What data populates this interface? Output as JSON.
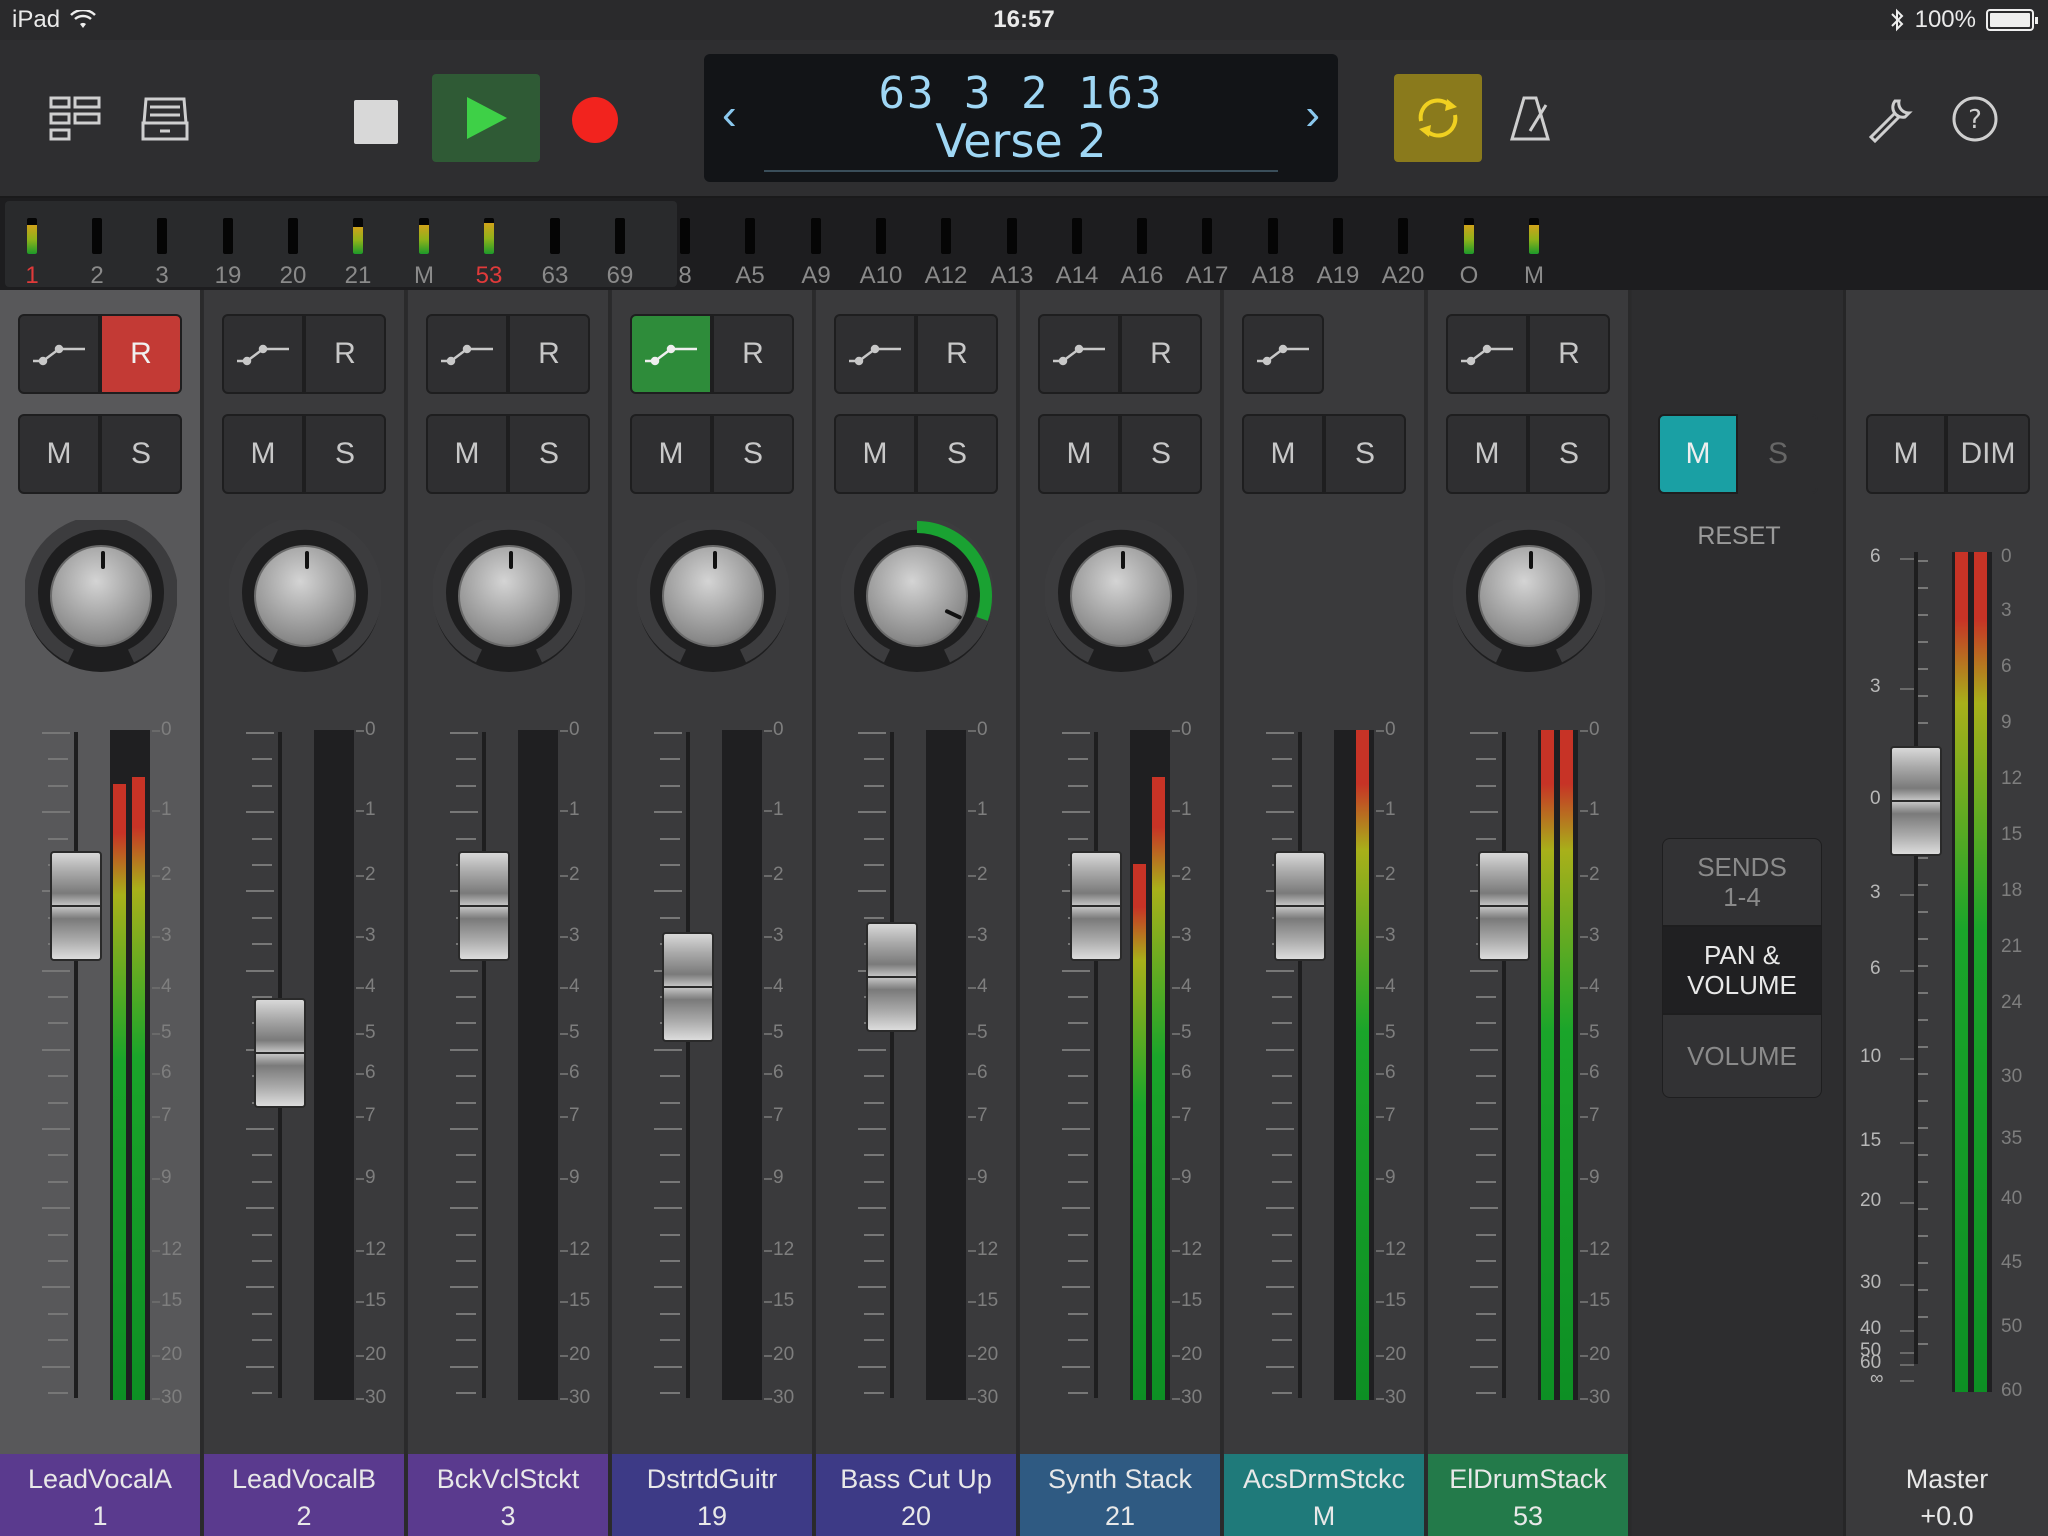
{
  "status": {
    "device": "iPad",
    "time": "16:57",
    "battery": "100%"
  },
  "toolbar": {
    "lcd_position": "63 3 2 163",
    "lcd_section": "Verse 2"
  },
  "meter_bank": [
    {
      "label": "1",
      "red": true,
      "level": 0.8
    },
    {
      "label": "2",
      "red": false,
      "level": 0
    },
    {
      "label": "3",
      "red": false,
      "level": 0
    },
    {
      "label": "19",
      "red": false,
      "level": 0
    },
    {
      "label": "20",
      "red": false,
      "level": 0
    },
    {
      "label": "21",
      "red": false,
      "level": 0.75
    },
    {
      "label": "M",
      "red": false,
      "level": 0.8
    },
    {
      "label": "53",
      "red": true,
      "level": 0.85
    },
    {
      "label": "63",
      "red": false,
      "level": 0
    },
    {
      "label": "69",
      "red": false,
      "level": 0
    },
    {
      "label": "8",
      "red": false,
      "level": 0
    },
    {
      "label": "A5",
      "red": false,
      "level": 0
    },
    {
      "label": "A9",
      "red": false,
      "level": 0
    },
    {
      "label": "A10",
      "red": false,
      "level": 0
    },
    {
      "label": "A12",
      "red": false,
      "level": 0
    },
    {
      "label": "A13",
      "red": false,
      "level": 0
    },
    {
      "label": "A14",
      "red": false,
      "level": 0
    },
    {
      "label": "A16",
      "red": false,
      "level": 0
    },
    {
      "label": "A17",
      "red": false,
      "level": 0
    },
    {
      "label": "A18",
      "red": false,
      "level": 0
    },
    {
      "label": "A19",
      "red": false,
      "level": 0
    },
    {
      "label": "A20",
      "red": false,
      "level": 0
    },
    {
      "label": "O",
      "red": false,
      "level": 0.8
    },
    {
      "label": "M",
      "red": false,
      "level": 0.8
    }
  ],
  "channel_scale": [
    "0",
    "1",
    "2",
    "3",
    "4",
    "5",
    "6",
    "7",
    "9",
    "12",
    "15",
    "20",
    "30"
  ],
  "strips": [
    {
      "name": "LeadVocalA",
      "number": "1",
      "color": "#5a3a8e",
      "m_label": "M",
      "s_label": "S",
      "r_label": "R",
      "record_armed": true,
      "automation_on": false,
      "has_r": true,
      "has_knob": true,
      "knob_value": 0,
      "fader_db": -2.5,
      "meter": [
        0.92,
        0.93
      ],
      "selected": true
    },
    {
      "name": "LeadVocalB",
      "number": "2",
      "color": "#5a3a8e",
      "m_label": "M",
      "s_label": "S",
      "r_label": "R",
      "record_armed": false,
      "automation_on": false,
      "has_r": true,
      "has_knob": true,
      "knob_value": 0,
      "fader_db": -5.5,
      "meter": [
        0,
        0
      ],
      "selected": false
    },
    {
      "name": "BckVclStckt",
      "number": "3",
      "color": "#5a3a8e",
      "m_label": "M",
      "s_label": "S",
      "r_label": "R",
      "record_armed": false,
      "automation_on": false,
      "has_r": true,
      "has_knob": true,
      "knob_value": 0,
      "fader_db": -2.5,
      "meter": [
        0,
        0
      ],
      "selected": false
    },
    {
      "name": "DstrtdGuitr",
      "number": "19",
      "color": "#3d3a86",
      "m_label": "M",
      "s_label": "S",
      "r_label": "R",
      "record_armed": false,
      "automation_on": true,
      "has_r": true,
      "has_knob": true,
      "knob_value": 0,
      "fader_db": -4.0,
      "meter": [
        0,
        0
      ],
      "selected": false
    },
    {
      "name": "Bass Cut Up",
      "number": "20",
      "color": "#3d3a86",
      "m_label": "M",
      "s_label": "S",
      "r_label": "R",
      "record_armed": false,
      "automation_on": false,
      "has_r": true,
      "has_knob": true,
      "knob_value": 0.45,
      "fader_db": -3.8,
      "meter": [
        0,
        0
      ],
      "selected": false
    },
    {
      "name": "Synth Stack",
      "number": "21",
      "color": "#2f5a82",
      "m_label": "M",
      "s_label": "S",
      "r_label": "R",
      "record_armed": false,
      "automation_on": false,
      "has_r": true,
      "has_knob": true,
      "knob_value": 0,
      "fader_db": -2.5,
      "meter": [
        0.8,
        0.93
      ],
      "selected": false
    },
    {
      "name": "AcsDrmStckc",
      "number": "M",
      "color": "#1f7a7a",
      "m_label": "M",
      "s_label": "S",
      "r_label": "",
      "record_armed": false,
      "automation_on": false,
      "has_r": false,
      "has_knob": false,
      "knob_value": 0,
      "fader_db": -2.5,
      "meter": [
        0,
        1.0
      ],
      "selected": false
    },
    {
      "name": "ElDrumStack",
      "number": "53",
      "color": "#237a4a",
      "m_label": "M",
      "s_label": "S",
      "r_label": "R",
      "record_armed": false,
      "automation_on": false,
      "has_r": true,
      "has_knob": true,
      "knob_value": 0,
      "fader_db": -2.5,
      "meter": [
        1.0,
        1.0
      ],
      "selected": false
    }
  ],
  "control": {
    "m_label": "M",
    "s_label": "S",
    "reset": "RESET",
    "sends": "SENDS\n1-4",
    "pan_volume": "PAN &\nVOLUME",
    "volume": "VOLUME"
  },
  "master": {
    "name": "Master",
    "value": "+0.0",
    "m_label": "M",
    "dim_label": "DIM",
    "fader_db": 0,
    "meter": [
      1.0,
      1.0
    ],
    "left_scale": [
      "6",
      "3",
      "0",
      "3",
      "6",
      "10",
      "15",
      "20",
      "30",
      "40",
      "50",
      "60",
      "∞"
    ],
    "right_scale": [
      "0",
      "3",
      "6",
      "9",
      "12",
      "15",
      "18",
      "21",
      "24",
      "30",
      "35",
      "40",
      "45",
      "50",
      "60"
    ]
  }
}
